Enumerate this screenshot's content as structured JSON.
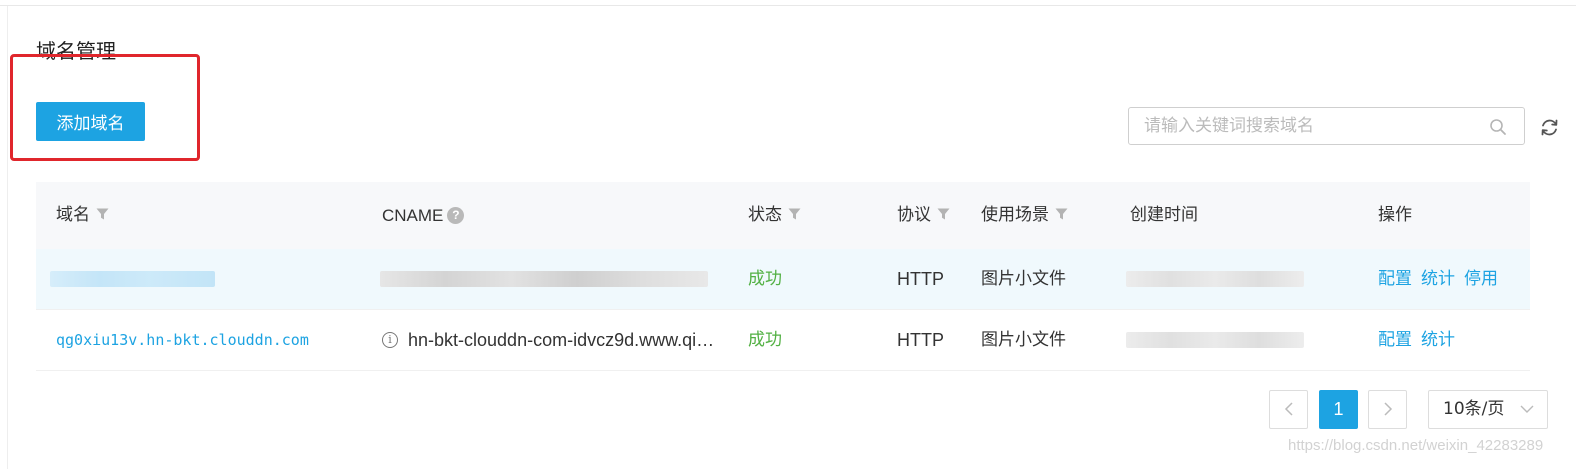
{
  "page": {
    "title": "域名管理"
  },
  "toolbar": {
    "add_domain_label": "添加域名",
    "search_placeholder": "请输入关键词搜索域名"
  },
  "table": {
    "columns": {
      "domain": "域名",
      "cname": "CNAME",
      "status": "状态",
      "protocol": "协议",
      "scenario": "使用场景",
      "created": "创建时间",
      "actions": "操作"
    },
    "rows": [
      {
        "domain": "",
        "cname": "",
        "status": "成功",
        "protocol": "HTTP",
        "scenario": "图片小文件",
        "created": "",
        "actions": [
          "配置",
          "统计",
          "停用"
        ]
      },
      {
        "domain": "qg0xiu13v.hn-bkt.clouddn.com",
        "cname": "hn-bkt-clouddn-com-idvcz9d.www.qi…",
        "status": "成功",
        "protocol": "HTTP",
        "scenario": "图片小文件",
        "created": "",
        "actions": [
          "配置",
          "统计"
        ]
      }
    ]
  },
  "pagination": {
    "prev": "<",
    "current_page": "1",
    "next": ">",
    "page_size": "10条/页"
  },
  "watermark": "https://blog.csdn.net/weixin_42283289",
  "colors": {
    "accent": "#1da3e2",
    "success": "#52b043",
    "annotation": "#e0262c",
    "header_bg": "#f7f8fa",
    "row_highlight": "#f0f9fd"
  },
  "icons": {
    "search": "search-icon",
    "refresh": "refresh-icon",
    "filter": "filter-icon",
    "help": "question-circle-icon",
    "info": "info-circle-icon",
    "page_size_arrow": "chevron-down-icon"
  }
}
